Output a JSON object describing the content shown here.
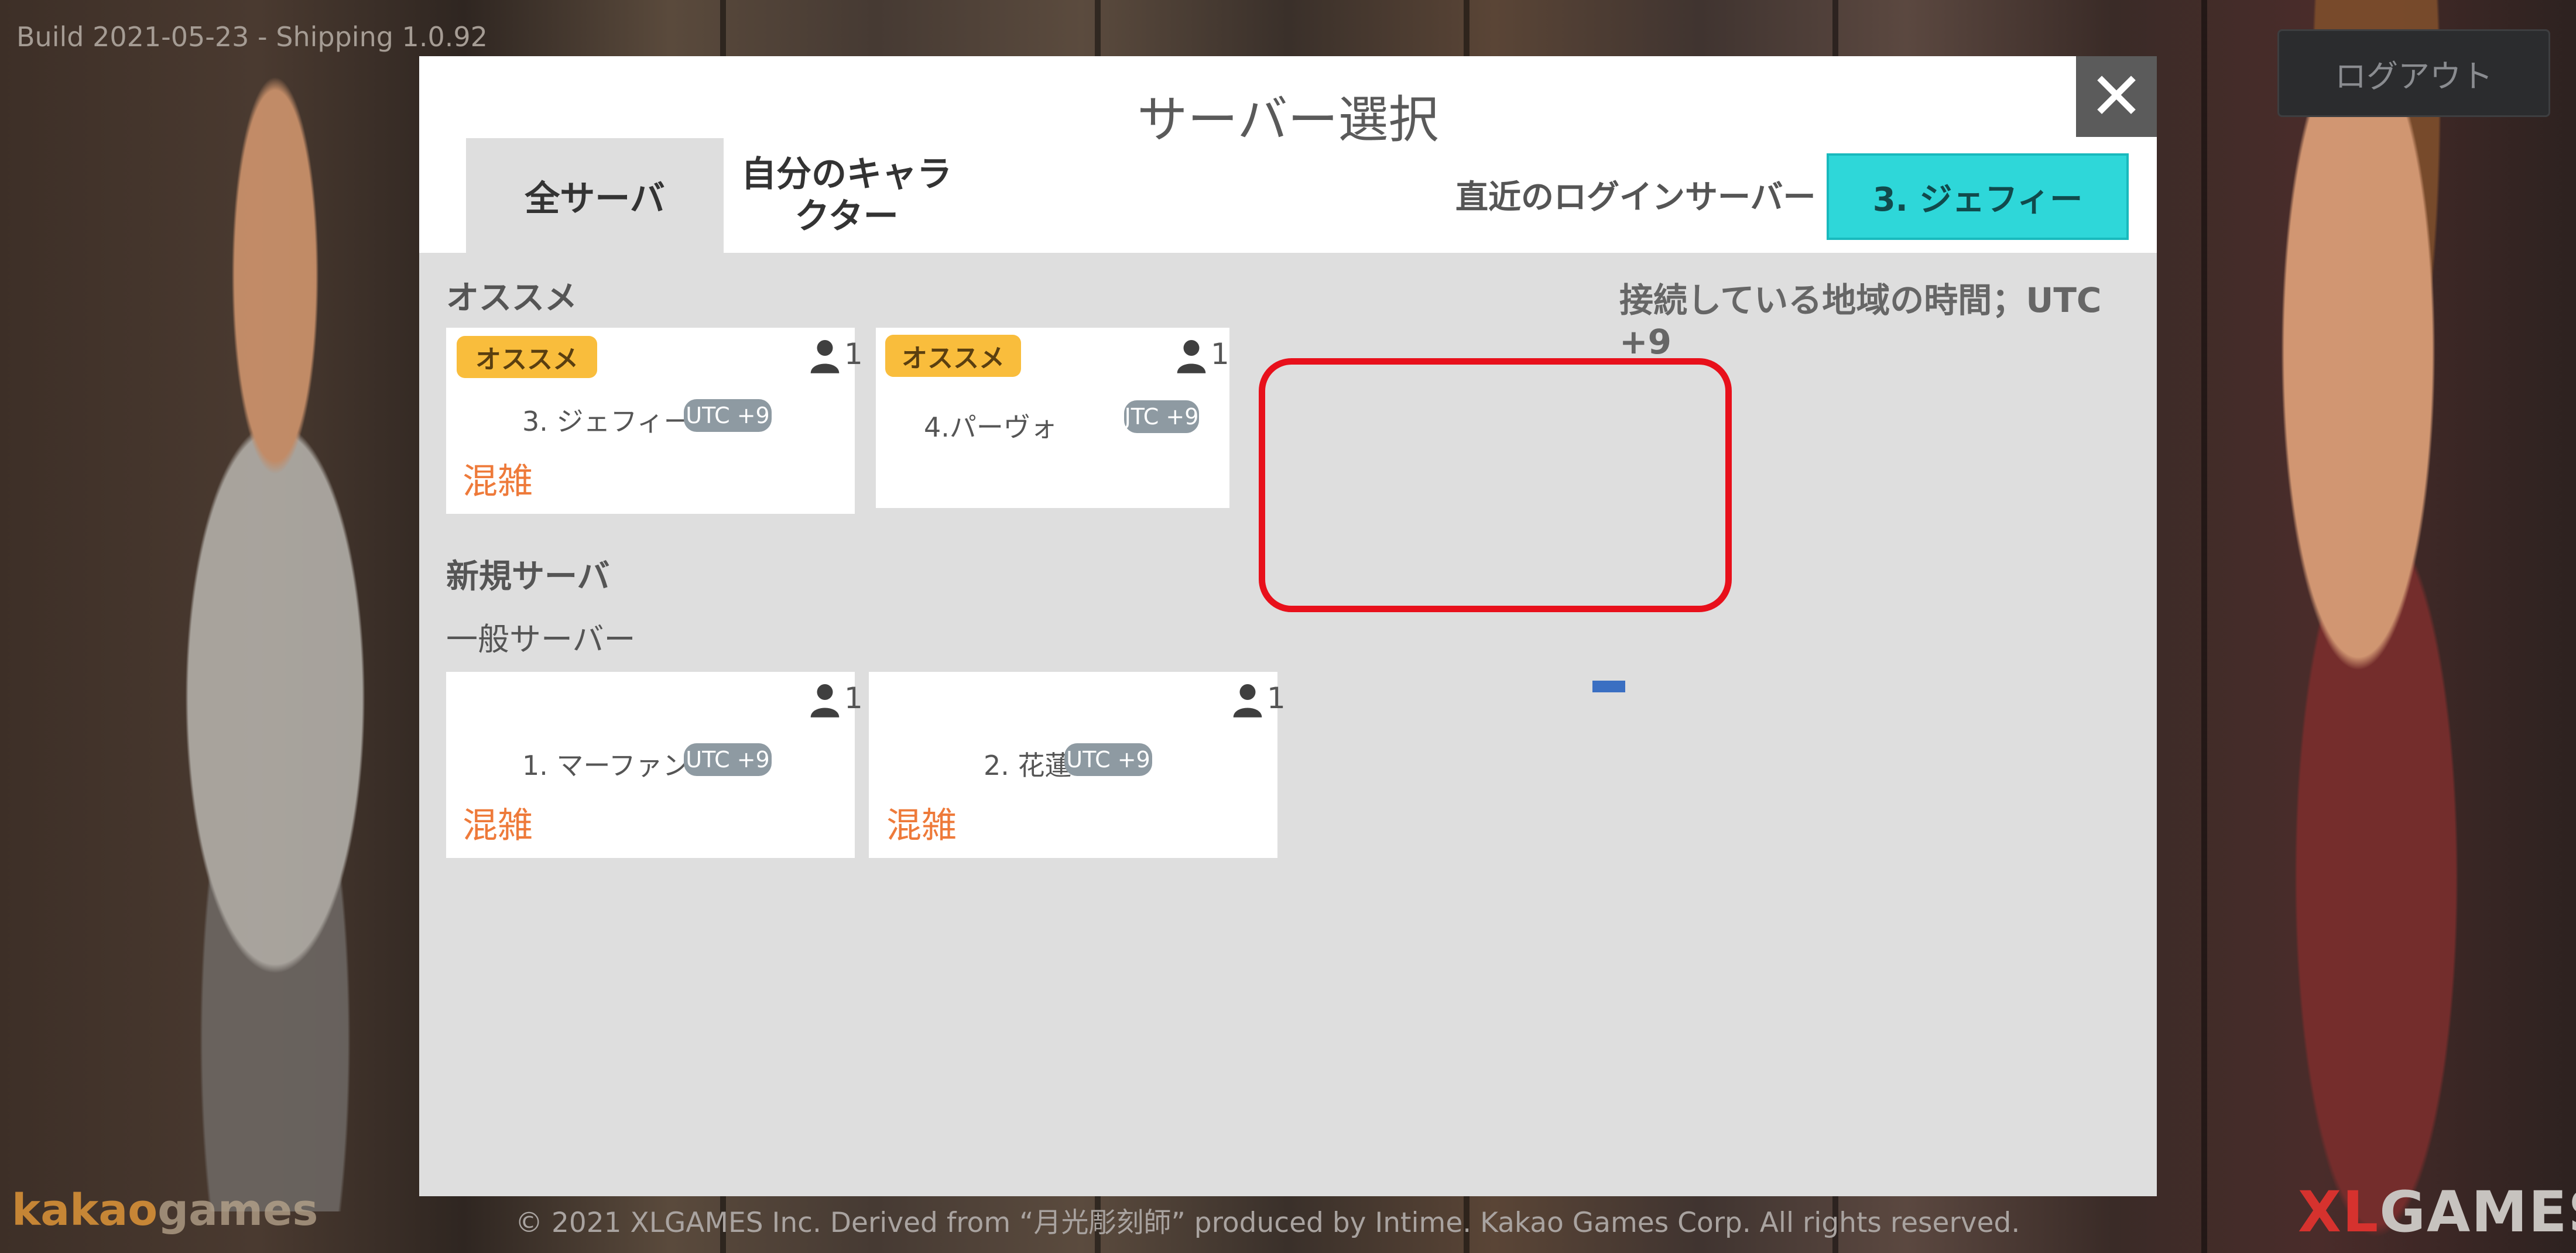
{
  "build_text": "Build 2021-05-23 - Shipping 1.0.92",
  "logout_label": "ログアウト",
  "footer": {
    "kakao_a": "kakao",
    "kakao_b": "games",
    "copyright": "© 2021 XLGAMES Inc. Derived from “月光彫刻師” produced by Intime. Kakao Games Corp. All rights reserved.",
    "xl_a": "XL",
    "xl_b": "GAMES"
  },
  "dialog": {
    "title": "サーバー選択",
    "close_icon": "close-icon",
    "tabs": [
      {
        "label": "全サーバ"
      },
      {
        "label": "自分のキャラクター"
      }
    ],
    "recent_label": "直近のログインサーバー",
    "recent_button": "3. ジェフィー",
    "timezone_text": "接続している地域の時間；UTC +9",
    "recommended_section": "オススメ",
    "new_section": "新規サーバ",
    "general_section": "一般サーバー",
    "recommended_cards": [
      {
        "badge": "オススメ",
        "users": "1",
        "name": "3. ジェフィー",
        "utc": "UTC +9",
        "status": "混雑"
      },
      {
        "badge": "オススメ",
        "users": "1",
        "name": "4.パーヴォ",
        "utc": "JTC +9",
        "status": ""
      }
    ],
    "general_cards": [
      {
        "users": "1",
        "name": "1. マーファン",
        "utc": "UTC +9",
        "status": "混雑"
      },
      {
        "users": "1",
        "name": "2. 花蓮",
        "utc": "UTC +9",
        "status": "混雑"
      }
    ]
  },
  "colors": {
    "accent": "#2ed7d9",
    "badge": "#f9bd3c",
    "status": "#ee7a3a",
    "highlight": "#e8101b"
  }
}
